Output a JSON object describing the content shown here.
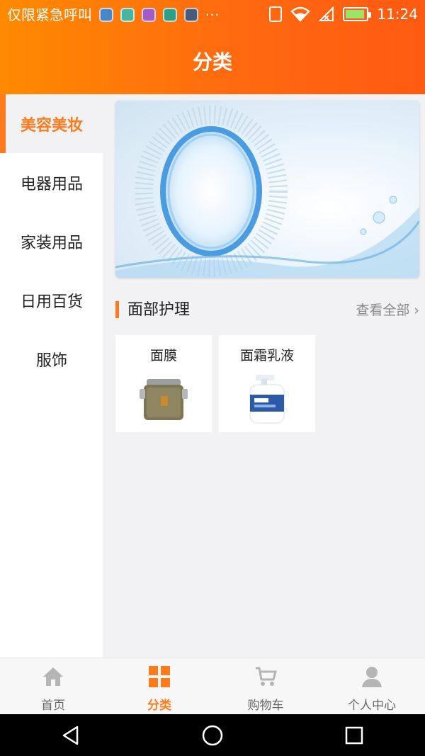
{
  "status_bar": {
    "carrier": "仅限紧急呼叫",
    "more": "···",
    "time": "11:24"
  },
  "header": {
    "title": "分类"
  },
  "sidebar": {
    "items": [
      {
        "label": "美容美妆",
        "active": true
      },
      {
        "label": "电器用品",
        "active": false
      },
      {
        "label": "家装用品",
        "active": false
      },
      {
        "label": "日用百货",
        "active": false
      },
      {
        "label": "服饰",
        "active": false
      }
    ]
  },
  "section": {
    "title": "面部护理",
    "view_all": "查看全部",
    "chevron": "›"
  },
  "products": [
    {
      "name": "面膜",
      "icon": "jar-icon"
    },
    {
      "name": "面霜乳液",
      "icon": "cream-pump-bottle-icon"
    }
  ],
  "tabbar": {
    "tabs": [
      {
        "label": "首页",
        "icon": "home-icon"
      },
      {
        "label": "分类",
        "icon": "grid-icon"
      },
      {
        "label": "购物车",
        "icon": "cart-icon"
      },
      {
        "label": "个人中心",
        "icon": "user-icon"
      }
    ]
  },
  "colors": {
    "accent": "#ff7a1a",
    "header_start": "#ff8a00",
    "header_end": "#ff5a12"
  }
}
